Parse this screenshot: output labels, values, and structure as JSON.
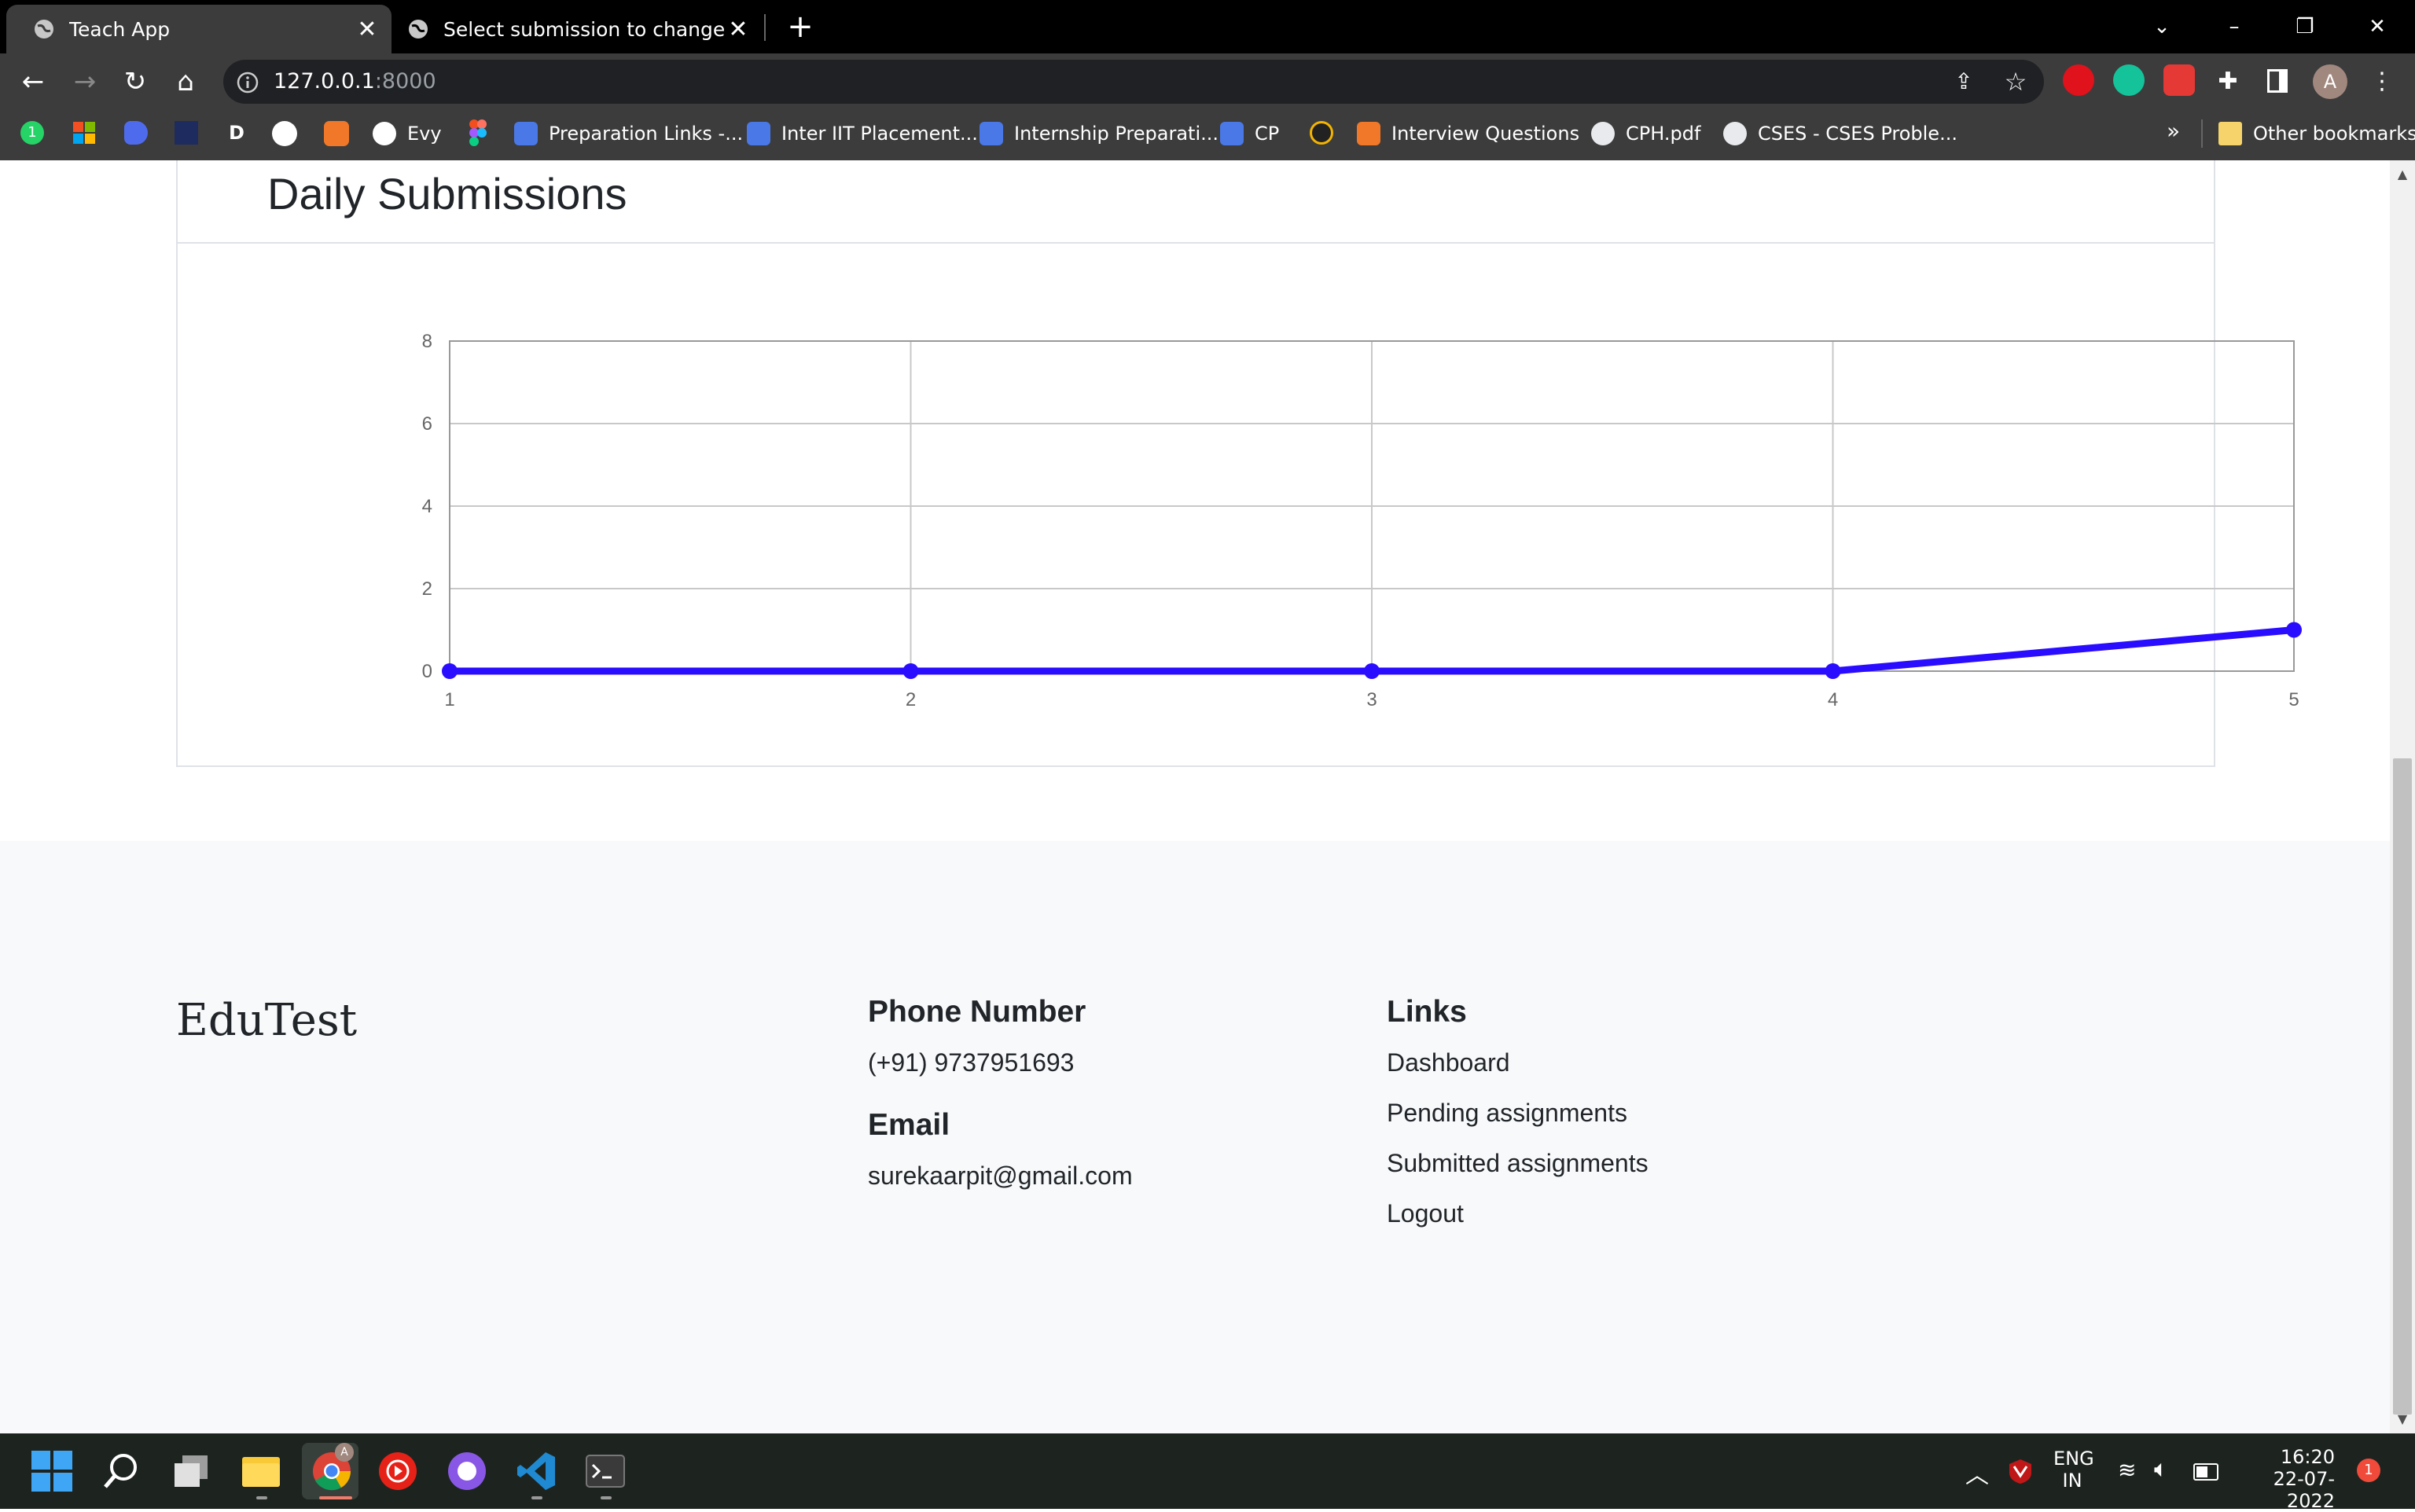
{
  "browser": {
    "tabs": [
      {
        "title": "Teach App",
        "active": true
      },
      {
        "title": "Select submission to change | Dja",
        "active": false
      }
    ],
    "url_host": "127.0.0.1",
    "url_port": ":8000",
    "profile_initial": "A",
    "bookmarks": [
      "Evy",
      "Preparation Links -...",
      "Inter IIT Placement...",
      "Internship Preparati...",
      "CP",
      "Interview Questions",
      "CPH.pdf",
      "CSES - CSES Proble..."
    ],
    "bookmark_badge": "1",
    "bookmark_d": "D",
    "overflow": "»",
    "other_bookmarks": "Other bookmarks"
  },
  "card": {
    "title": "Daily Submissions"
  },
  "chart_data": {
    "type": "line",
    "x": [
      1,
      2,
      3,
      4,
      5
    ],
    "series": [
      {
        "values": [
          0,
          0,
          0,
          0,
          1
        ],
        "color": "#2a0dff"
      }
    ],
    "ylim": [
      0,
      8
    ],
    "yticks": [
      0,
      2,
      4,
      6,
      8
    ],
    "xticks": [
      1,
      2,
      3,
      4,
      5
    ],
    "grid": true,
    "title": "",
    "xlabel": "",
    "ylabel": ""
  },
  "footer": {
    "brand": "EduTest",
    "phone_heading": "Phone Number",
    "phone": "(+91) 9737951693",
    "email_heading": "Email",
    "email": "surekaarpit@gmail.com",
    "links_heading": "Links",
    "links": [
      "Dashboard",
      "Pending assignments",
      "Submitted assignments",
      "Logout"
    ]
  },
  "taskbar": {
    "lang": "ENG",
    "region": "IN",
    "time": "16:20",
    "date": "22-07-2022",
    "notification_count": "1",
    "chrome_badge": "A"
  }
}
